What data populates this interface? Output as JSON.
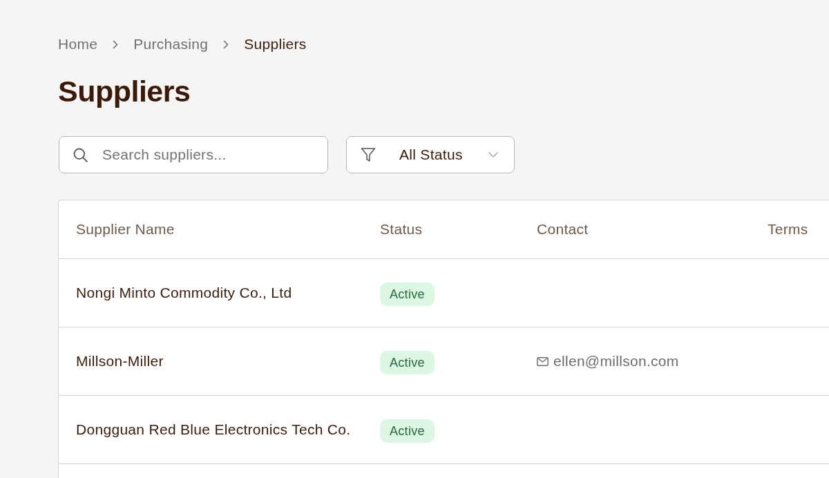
{
  "breadcrumb": [
    {
      "label": "Home",
      "current": false
    },
    {
      "label": "Purchasing",
      "current": false
    },
    {
      "label": "Suppliers",
      "current": true
    }
  ],
  "page_title": "Suppliers",
  "search": {
    "placeholder": "Search suppliers..."
  },
  "status_filter": {
    "value": "All Status"
  },
  "table": {
    "columns": [
      "Supplier Name",
      "Status",
      "Contact",
      "Terms"
    ],
    "rows": [
      {
        "name": "Nongi Minto Commodity Co., Ltd",
        "status": "Active"
      },
      {
        "name": "Millson-Miller",
        "status": "Active",
        "contact_email": "ellen@millson.com"
      },
      {
        "name": "Dongguan Red Blue Electronics Tech Co.",
        "status": "Active"
      }
    ]
  }
}
